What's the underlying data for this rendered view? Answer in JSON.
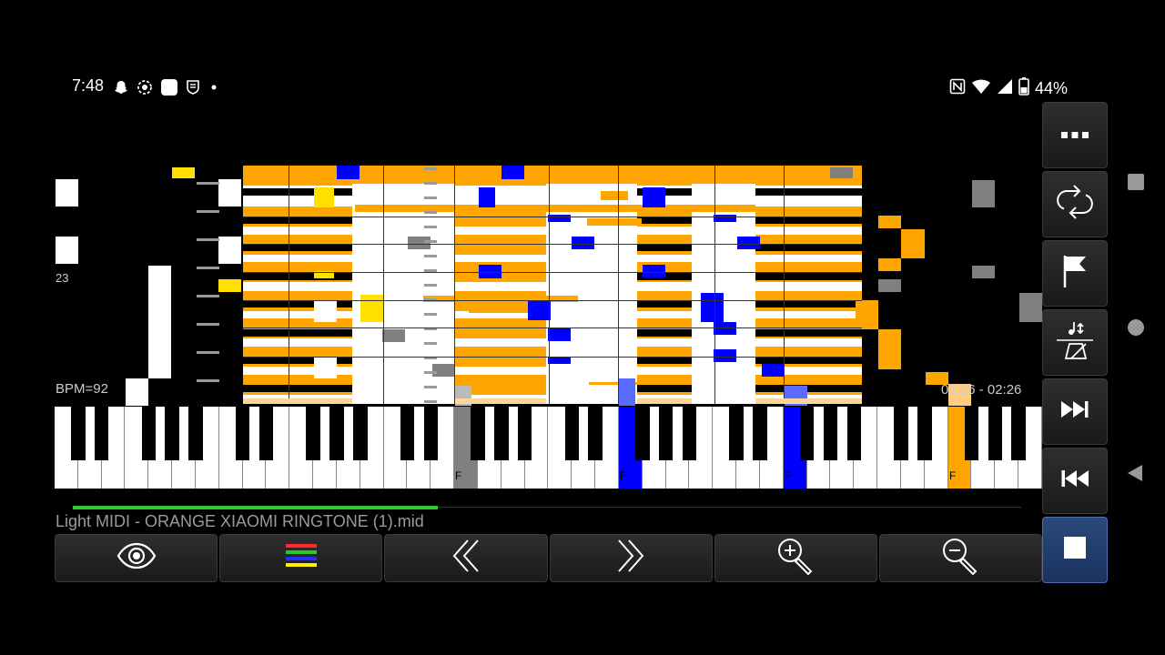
{
  "status_bar": {
    "time": "7:48",
    "left_icons": [
      "snapchat-icon",
      "screen-record-icon",
      "app-icon",
      "shield-app-icon",
      "more-dot-icon"
    ],
    "right_icons": [
      "nfc-icon",
      "wifi-icon",
      "signal-icon",
      "battery-icon"
    ],
    "battery": "44%"
  },
  "player": {
    "bpm": "BPM=92",
    "time_range": "02:26 - 02:26",
    "side_number": "23",
    "key_label": "F",
    "progress_fraction": 0.385,
    "file_name": "Light MIDI - ORANGE XIAOMI RINGTONE (1).mid",
    "colors": {
      "note_primary": "#FFA500",
      "note_highlight": "#0000FF",
      "note_secondary": "#FFE000",
      "note_muted": "#808080",
      "progress": "#2ECC2E",
      "stop_active": "#1A3260"
    }
  },
  "bottom_toolbar": [
    {
      "name": "visibility-button",
      "icon": "eye-icon"
    },
    {
      "name": "tracks-button",
      "icon": "color-bars-icon"
    },
    {
      "name": "rewind-button",
      "icon": "double-chevron-left-icon"
    },
    {
      "name": "forward-button",
      "icon": "double-chevron-right-icon"
    },
    {
      "name": "zoom-in-button",
      "icon": "zoom-in-icon"
    },
    {
      "name": "zoom-out-button",
      "icon": "zoom-out-icon"
    }
  ],
  "side_toolbar": [
    {
      "name": "menu-button",
      "icon": "ellipsis-icon"
    },
    {
      "name": "loop-button",
      "icon": "loop-icon"
    },
    {
      "name": "flag-button",
      "icon": "flag-icon"
    },
    {
      "name": "metronome-button",
      "icon": "metronome-icon"
    },
    {
      "name": "skip-forward-button",
      "icon": "skip-forward-icon"
    },
    {
      "name": "skip-back-button",
      "icon": "skip-back-icon"
    },
    {
      "name": "stop-button",
      "icon": "stop-icon"
    }
  ],
  "nav_bar": [
    "nav-recents-icon",
    "nav-home-icon",
    "nav-back-icon"
  ]
}
